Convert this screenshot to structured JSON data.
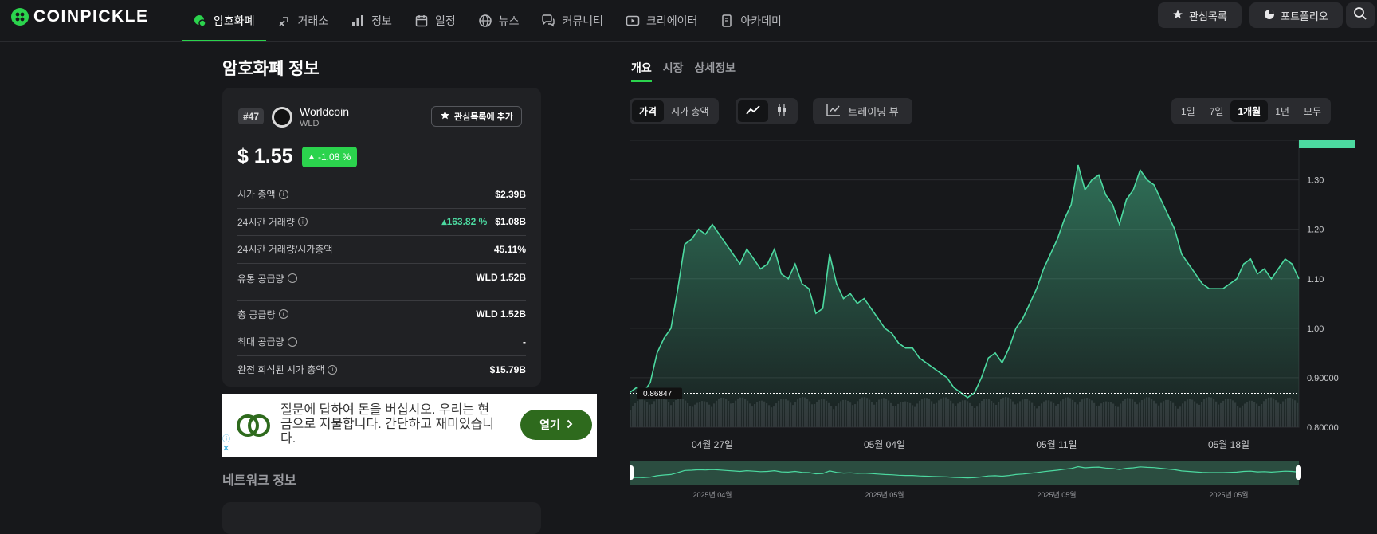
{
  "brand": {
    "name": "COINPICKLE",
    "accent": "#2bd34d"
  },
  "nav": {
    "items": [
      {
        "label": "암호화폐",
        "icon": "coin-icon",
        "active": true
      },
      {
        "label": "거래소",
        "icon": "exchange-icon"
      },
      {
        "label": "정보",
        "icon": "bar-chart-icon"
      },
      {
        "label": "일정",
        "icon": "calendar-icon"
      },
      {
        "label": "뉴스",
        "icon": "globe-icon"
      },
      {
        "label": "커뮤니티",
        "icon": "chat-icon"
      },
      {
        "label": "크리에이터",
        "icon": "play-icon"
      },
      {
        "label": "아카데미",
        "icon": "book-icon"
      }
    ],
    "watchlist_label": "관심목록",
    "portfolio_label": "포트폴리오"
  },
  "page_title": "암호화폐 정보",
  "coin": {
    "rank": "#47",
    "name": "Worldcoin",
    "symbol": "WLD",
    "add_watch_label": "관심목록에 추가",
    "price": "$ 1.55",
    "change": "-1.08 %",
    "stats": [
      {
        "label": "시가 총액",
        "value": "$2.39B",
        "info": true
      },
      {
        "label": "24시간 거래량",
        "value": "$1.08B",
        "change": "163.82 %",
        "info": true
      },
      {
        "label": "24시간 거래량/시가총액",
        "value": "45.11%",
        "info": false
      },
      {
        "label": "유통 공급량",
        "value": "WLD 1.52B",
        "info": true
      },
      {
        "label": "총 공급량",
        "value": "WLD 1.52B",
        "info": true
      },
      {
        "label": "최대 공급량",
        "value": "-",
        "info": true
      },
      {
        "label": "완전 희석된 시가 총액",
        "value": "$15.79B",
        "info": true
      }
    ]
  },
  "ad": {
    "text": "질문에 답하여 돈을 버십시오. 우리는 현금으로 지불합니다. 간단하고 재미있습니다.",
    "button": "열기"
  },
  "network_title": "네트워크 정보",
  "detail_tabs": [
    "개요",
    "시장",
    "상세정보"
  ],
  "chart_controls": {
    "metric_options": [
      "가격",
      "시가 총액"
    ],
    "tradingview_label": "트레이딩 뷰",
    "ranges": [
      "1일",
      "7일",
      "1개월",
      "1년",
      "모두"
    ],
    "active_range": "1개월"
  },
  "chart_data": {
    "type": "area",
    "x_labels": [
      "04월 27일",
      "05월 04일",
      "05월 11일",
      "05월 18일"
    ],
    "navigator_labels": [
      "2025년 04월",
      "2025년 05월",
      "2025년 05월",
      "2025년 05월"
    ],
    "y_ticks": [
      "1.30",
      "1.20",
      "1.10",
      "1.00",
      "0.90000",
      "0.80000"
    ],
    "ylim": [
      0.8,
      1.38
    ],
    "reference_label": "0.86847",
    "reference_value": 0.86847,
    "line_color": "#4cd9a0",
    "values": [
      0.87,
      0.88,
      0.87,
      0.89,
      0.95,
      0.98,
      1.0,
      1.08,
      1.17,
      1.18,
      1.2,
      1.19,
      1.21,
      1.19,
      1.17,
      1.15,
      1.13,
      1.16,
      1.14,
      1.12,
      1.13,
      1.16,
      1.11,
      1.1,
      1.13,
      1.09,
      1.08,
      1.03,
      1.04,
      1.15,
      1.09,
      1.06,
      1.07,
      1.05,
      1.06,
      1.04,
      1.02,
      1.0,
      0.99,
      0.97,
      0.96,
      0.96,
      0.94,
      0.93,
      0.92,
      0.91,
      0.9,
      0.88,
      0.87,
      0.86,
      0.87,
      0.9,
      0.94,
      0.95,
      0.93,
      0.96,
      1.0,
      1.02,
      1.05,
      1.08,
      1.12,
      1.15,
      1.18,
      1.22,
      1.25,
      1.33,
      1.28,
      1.3,
      1.31,
      1.27,
      1.25,
      1.21,
      1.26,
      1.28,
      1.32,
      1.3,
      1.29,
      1.26,
      1.23,
      1.2,
      1.15,
      1.13,
      1.11,
      1.09,
      1.08,
      1.08,
      1.08,
      1.09,
      1.1,
      1.13,
      1.14,
      1.11,
      1.12,
      1.1,
      1.12,
      1.14,
      1.13,
      1.1
    ]
  }
}
